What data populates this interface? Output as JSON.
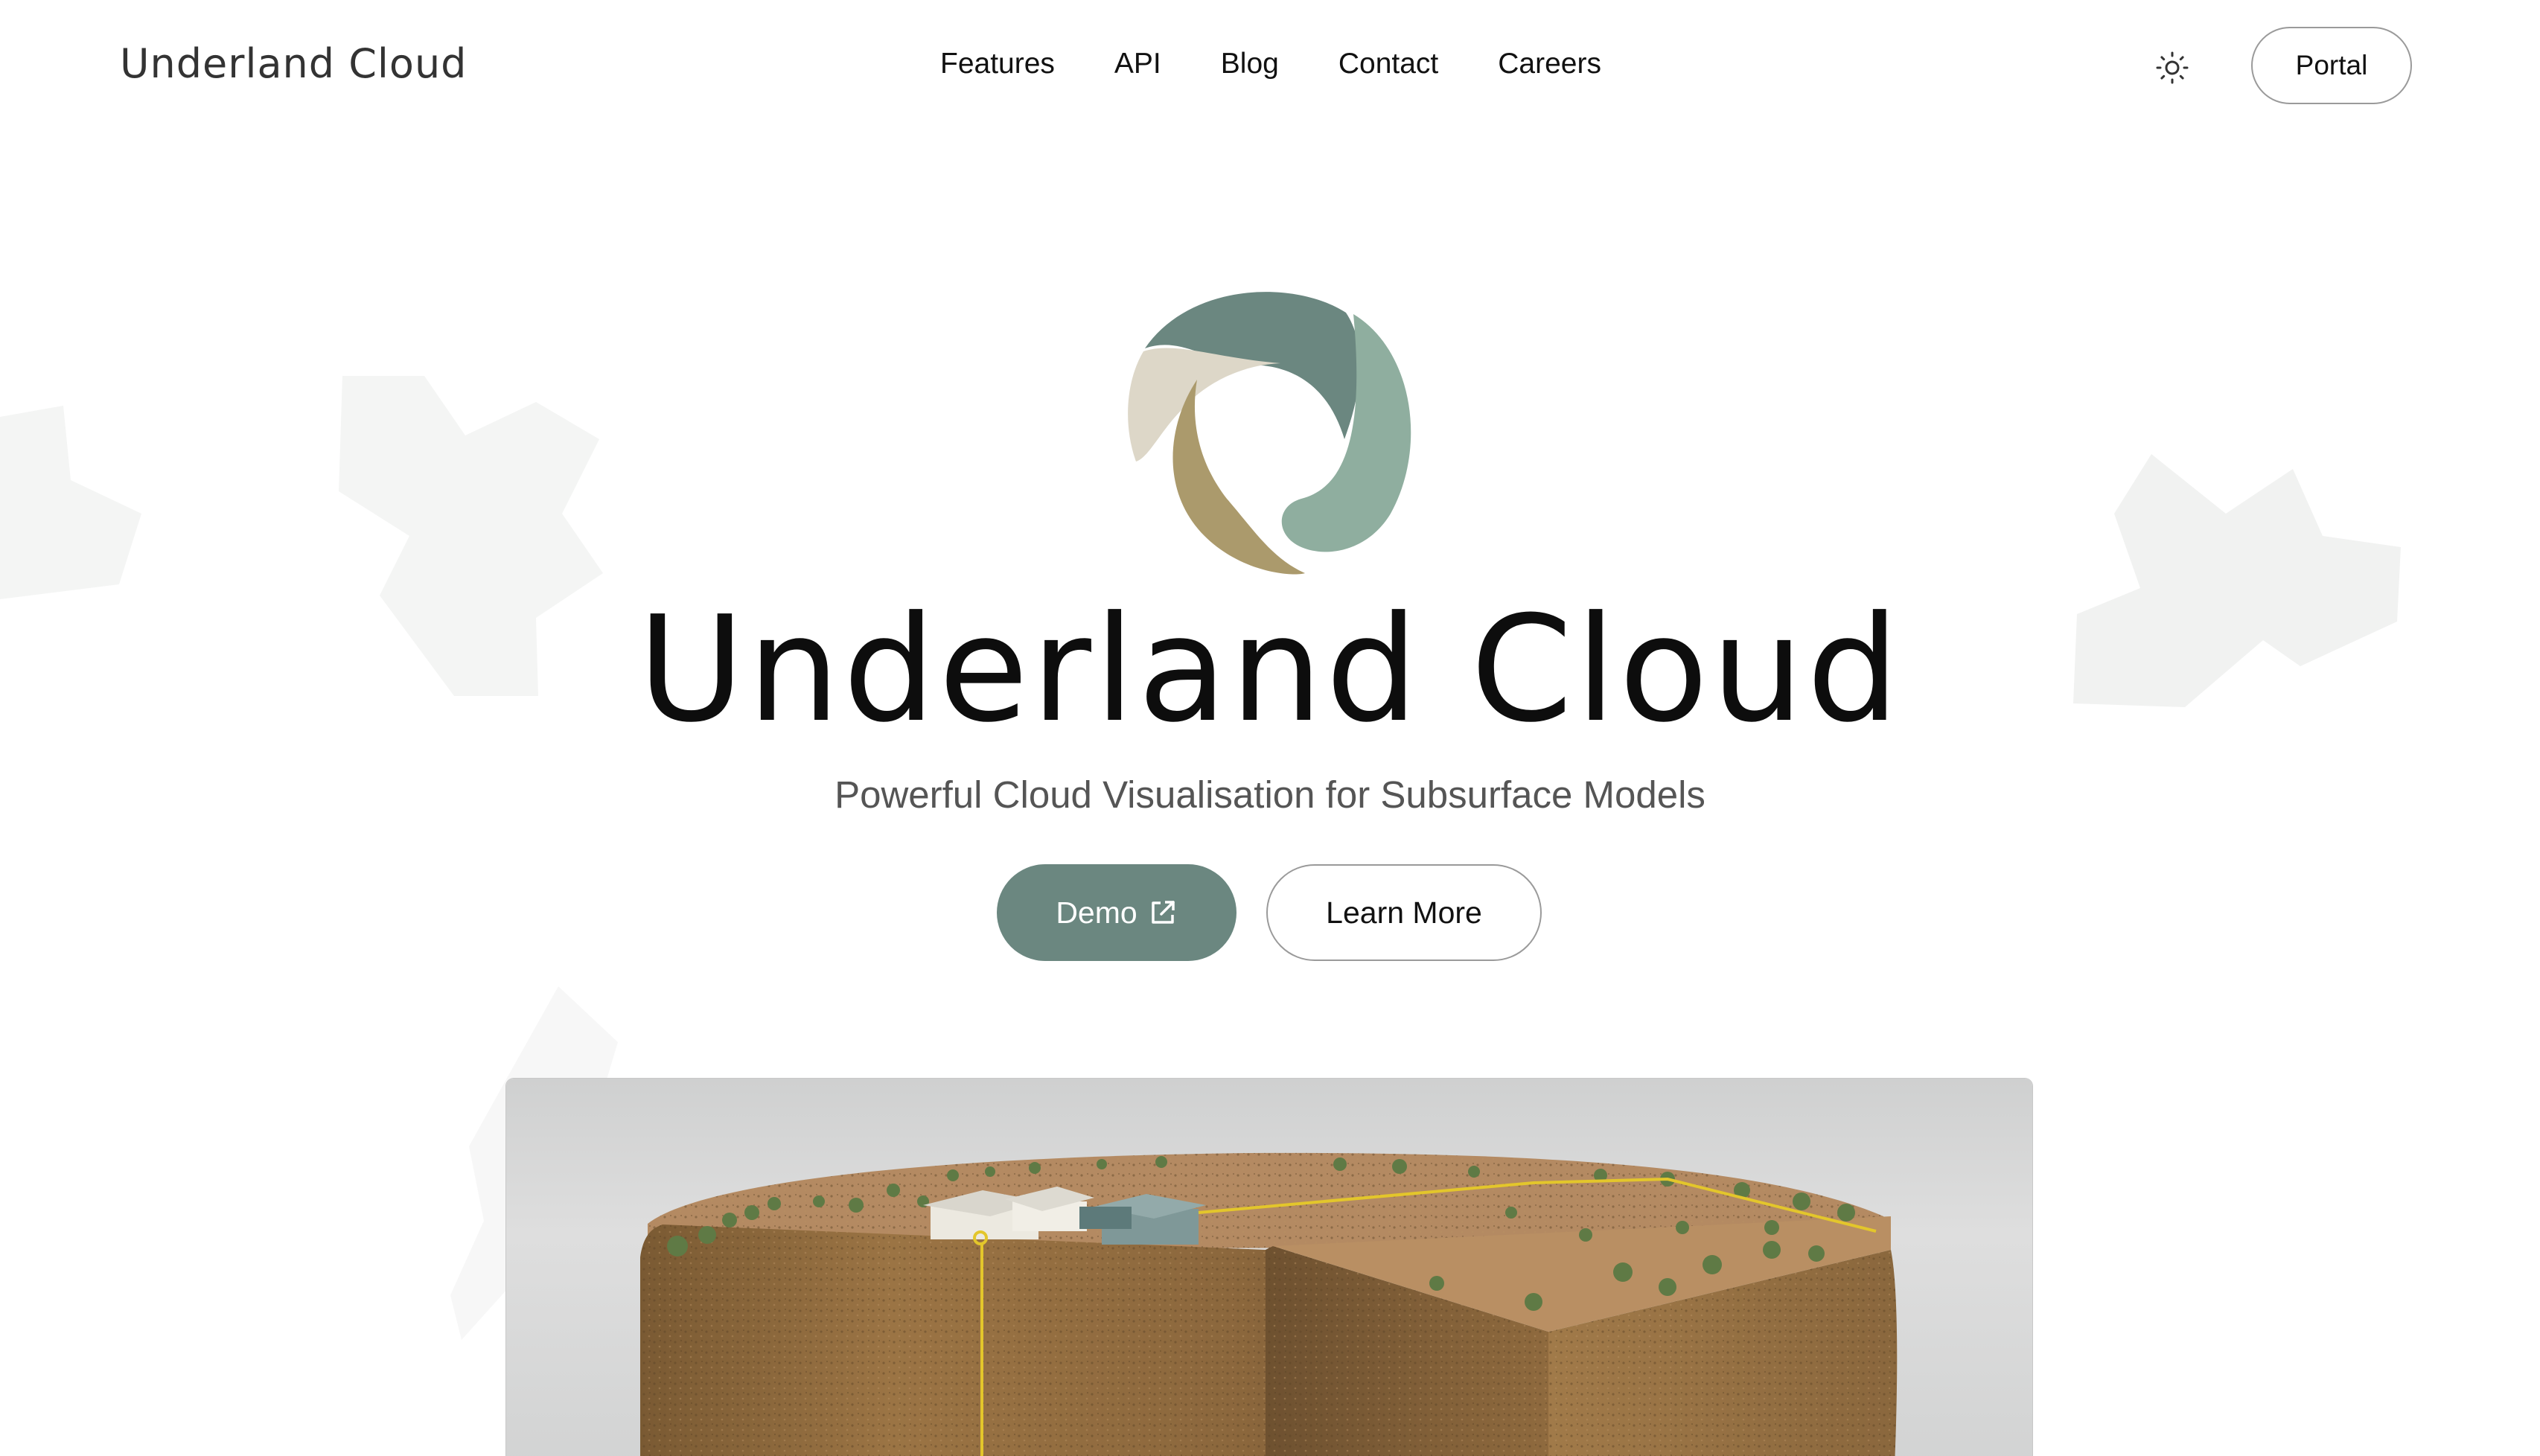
{
  "header": {
    "brand": "Underland Cloud",
    "nav": [
      "Features",
      "API",
      "Blog",
      "Contact",
      "Careers"
    ],
    "theme_icon": "sun-icon",
    "portal_label": "Portal"
  },
  "hero": {
    "title": "Underland Cloud",
    "tagline": "Powerful Cloud Visualisation for Subsurface Models",
    "demo_label": "Demo",
    "demo_icon": "external-link-icon",
    "learn_more_label": "Learn More"
  },
  "colors": {
    "accent": "#6b8780",
    "logo_dark_teal": "#6b8780",
    "logo_light_teal": "#8fae9f",
    "logo_tan": "#ab9a6c",
    "logo_beige": "#ddd7c8"
  }
}
